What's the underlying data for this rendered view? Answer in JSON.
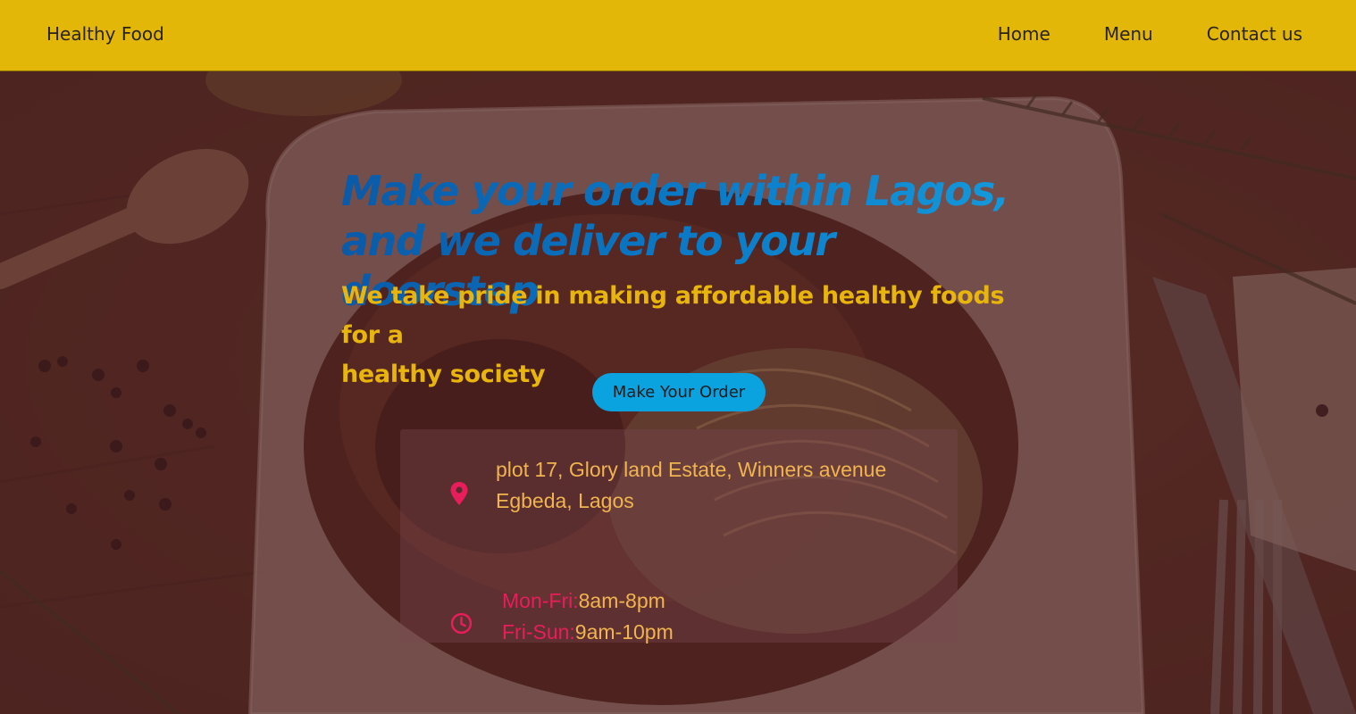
{
  "nav": {
    "brand": "Healthy Food",
    "links": [
      {
        "label": "Home"
      },
      {
        "label": "Menu"
      },
      {
        "label": "Contact us"
      }
    ]
  },
  "hero": {
    "headline_line1": "Make your order within Lagos,",
    "headline_line2": "and we deliver to your doorstep",
    "subheadline_line1": "We take pride in making affordable healthy foods for a",
    "subheadline_line2": "healthy society",
    "cta_label": "Make Your Order"
  },
  "info": {
    "address_line1": "plot 17, Glory land Estate, Winners avenue",
    "address_line2": "Egbeda, Lagos",
    "hours": [
      {
        "days": "Mon-Fri:",
        "time": "8am-8pm"
      },
      {
        "days": "Fri-Sun:",
        "time": "9am-10pm"
      }
    ],
    "icons": [
      "location-pin-icon",
      "clock-icon"
    ]
  },
  "colors": {
    "navbar": "#e3b707",
    "headline": "#0b7cc8",
    "subheadline": "#e8b50c",
    "cta": "#0aa3e0",
    "accent_pink": "#e81d5c",
    "accent_orange": "#f0b450"
  }
}
